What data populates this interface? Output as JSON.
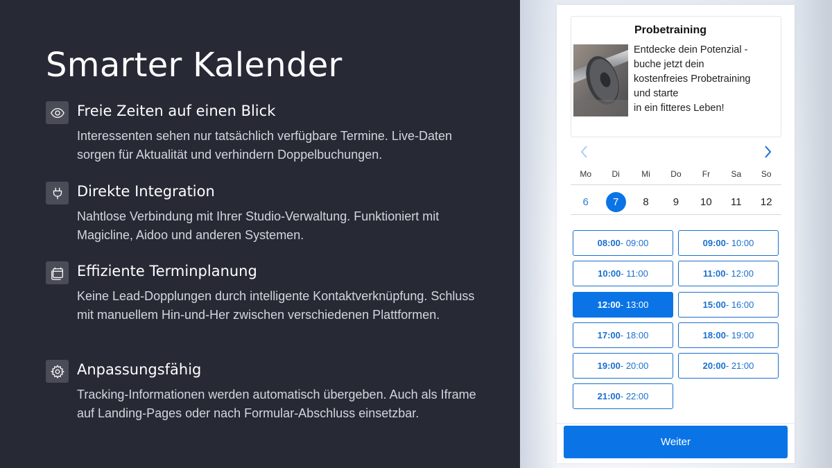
{
  "left": {
    "title": "Smarter Kalender",
    "features": [
      {
        "icon": "eye-icon",
        "heading": "Freie Zeiten auf einen Blick",
        "text": "Interessenten sehen nur tatsächlich verfügbare Termine. Live-Daten sorgen für Aktualität und verhindern Doppelbuchungen."
      },
      {
        "icon": "plug-icon",
        "heading": "Direkte Integration",
        "text": "Nahtlose Verbindung mit Ihrer Studio-Verwaltung. Funktioniert mit Magicline, Aidoo und anderen Systemen."
      },
      {
        "icon": "calendar-icon",
        "heading": "Effiziente Terminplanung",
        "text": "Keine Lead-Dopplungen durch intelligente Kontaktverknüpfung. Schluss mit manuellem Hin-und-Her zwischen verschiedenen Plattformen."
      },
      {
        "icon": "gear-icon",
        "heading": "Anpassungsfähig",
        "text": "Tracking-Informationen werden automatisch übergeben. Auch als Iframe auf Landing-Pages oder nach Formular-Abschluss einsetzbar."
      }
    ]
  },
  "widget": {
    "card": {
      "title": "Probetraining",
      "lines": [
        "Entdecke dein Potenzial -",
        "buche jetzt dein",
        "kostenfreies Probetraining",
        "und starte",
        "in ein fitteres Leben!"
      ]
    },
    "weekdays": [
      "Mo",
      "Di",
      "Mi",
      "Do",
      "Fr",
      "Sa",
      "So"
    ],
    "days": [
      "6",
      "7",
      "8",
      "9",
      "10",
      "11",
      "12"
    ],
    "selected_day": "7",
    "today_day": "6",
    "slots": [
      {
        "start": "08:00",
        "end": " - 09:00",
        "selected": false
      },
      {
        "start": "09:00",
        "end": " - 10:00",
        "selected": false
      },
      {
        "start": "10:00",
        "end": " - 11:00",
        "selected": false
      },
      {
        "start": "11:00",
        "end": " - 12:00",
        "selected": false
      },
      {
        "start": "12:00",
        "end": " - 13:00",
        "selected": true
      },
      {
        "start": "15:00",
        "end": " - 16:00",
        "selected": false
      },
      {
        "start": "17:00",
        "end": " - 18:00",
        "selected": false
      },
      {
        "start": "18:00",
        "end": " - 19:00",
        "selected": false
      },
      {
        "start": "19:00",
        "end": " - 20:00",
        "selected": false
      },
      {
        "start": "20:00",
        "end": " - 21:00",
        "selected": false
      },
      {
        "start": "21:00",
        "end": " - 22:00",
        "selected": false
      }
    ],
    "next_button": "Weiter"
  },
  "colors": {
    "left_bg": "#272a35",
    "accent": "#0a74e6",
    "slot_border": "#1a6fcf",
    "icon_bg": "#4a4d57"
  }
}
